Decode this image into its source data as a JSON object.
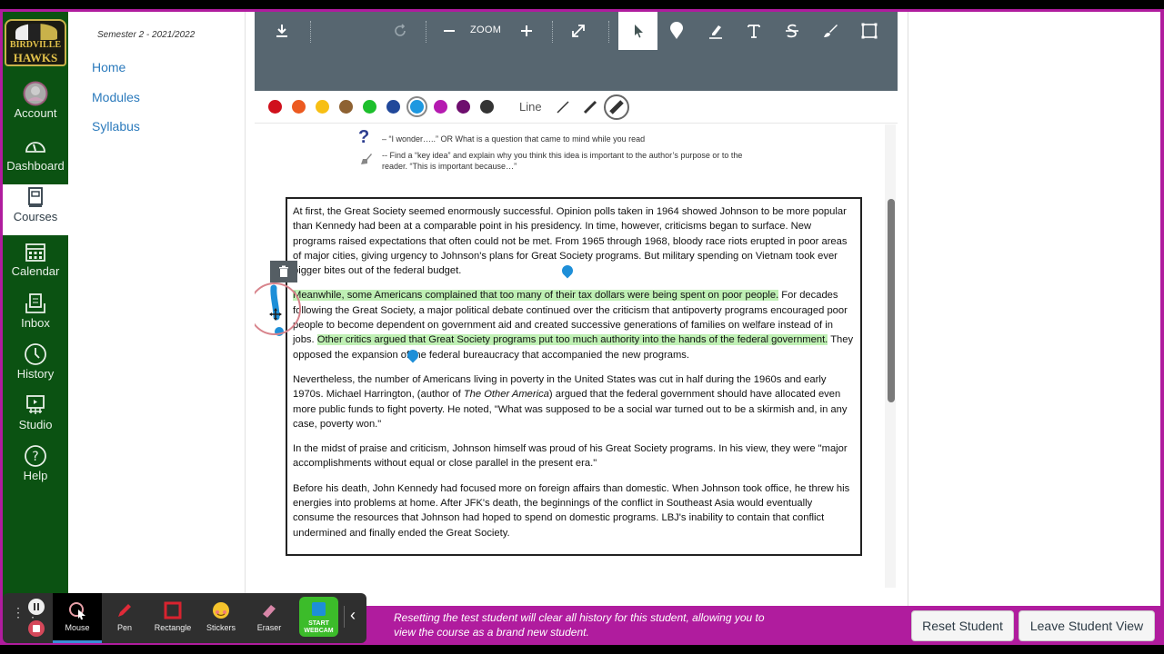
{
  "school_logo": {
    "line1": "BIRDVILLE",
    "line2": "HAWKS"
  },
  "global_nav": [
    {
      "label": "Account",
      "icon": "account-avatar-icon"
    },
    {
      "label": "Dashboard",
      "icon": "dashboard-icon"
    },
    {
      "label": "Courses",
      "icon": "courses-icon",
      "active": true
    },
    {
      "label": "Calendar",
      "icon": "calendar-icon"
    },
    {
      "label": "Inbox",
      "icon": "inbox-icon"
    },
    {
      "label": "History",
      "icon": "clock-icon"
    },
    {
      "label": "Studio",
      "icon": "studio-icon"
    },
    {
      "label": "Help",
      "icon": "help-icon"
    }
  ],
  "course_nav": {
    "term": "Semester 2 - 2021/2022",
    "links": [
      "Home",
      "Modules",
      "Syllabus"
    ]
  },
  "annotation_toolbar": {
    "zoom_label": "ZOOM",
    "tools": [
      "download-icon",
      "rotate-icon",
      "zoom-out-icon",
      "zoom-in-icon",
      "fullscreen-icon",
      "select-pointer-icon",
      "point-pin-icon",
      "highlight-icon",
      "text-icon",
      "strikeout-icon",
      "freehand-draw-icon",
      "area-icon"
    ],
    "selected_tool": "select-pointer-icon",
    "colors": [
      "#d0101c",
      "#ec5a20",
      "#f7bf14",
      "#8e6232",
      "#1dbf2c",
      "#21489a",
      "#1e98e0",
      "#b51ab0",
      "#6e0e6e",
      "#343434"
    ],
    "selected_color": "#1e98e0",
    "line_label": "Line",
    "line_widths": [
      "thin",
      "medium",
      "thick"
    ],
    "selected_line_width": "thick"
  },
  "document": {
    "legend": [
      {
        "icon": "question-mark-icon",
        "text": "– “I wonder…..” OR What is a question that came to mind while you read"
      },
      {
        "icon": "key-icon",
        "text": "-- Find a “key idea” and explain why you think this idea is important to the author’s purpose or to the reader. “This is important because…”"
      }
    ],
    "paragraphs": {
      "p1": "At first, the Great Society seemed enormously successful. Opinion polls taken in 1964 showed Johnson to be more popular than Kennedy had been at a comparable point in his presidency. In time, however, criticisms began to surface. New programs raised expectations that often could not be met. From 1965 through 1968, bloody race riots erupted in poor areas of major cities, giving urgency to Johnson's plans for Great Society programs. But military spending on Vietnam took ever bigger bites out of the federal budget.",
      "p2_highlight1": "Meanwhile, some Americans complained that too many of their tax dollars were being spent on poor people.",
      "p2_mid": " For decades following the Great Society, a major political debate continued over the criticism that antipoverty programs encouraged poor people to become dependent on government aid and created successive generations of families on welfare instead of in jobs. ",
      "p2_highlight2": "Other critics argued that Great Society programs put too much authority into the hands of the federal government.",
      "p2_end": " They opposed the expansion of the federal bureaucracy that accompanied the new programs.",
      "p3_a": "Nevertheless, the number of Americans living in poverty in the United States was cut in half during the 1960s and early 1970s. Michael Harrington, (author of ",
      "p3_italic": "The Other America",
      "p3_b": ") argued that the federal government should have allocated even more public funds to fight poverty. He noted, \"What was supposed to be a social war turned out to be a skirmish and, in any case, poverty won.\"",
      "p4": "In the midst of praise and criticism, Johnson himself was proud of his Great Society programs. In his view, they were \"major accomplishments without equal or close parallel in the present era.\"",
      "p5": "Before his death, John Kennedy had focused more on foreign affairs than domestic. When Johnson took office, he threw his energies into problems at home. After JFK's death, the beginnings of the conflict in Southeast Asia would eventually consume the resources that Johnson had hoped to spend on domestic programs. LBJ's inability to contain that conflict undermined and finally ended the Great Society."
    },
    "highlight_color": "#bff0b4",
    "pin_color": "#1e8fd8"
  },
  "recorder": {
    "tools": [
      {
        "label": "Mouse",
        "active": true
      },
      {
        "label": "Pen"
      },
      {
        "label": "Rectangle"
      },
      {
        "label": "Stickers"
      },
      {
        "label": "Eraser"
      }
    ],
    "webcam_label": "START WEBCAM"
  },
  "student_view": {
    "notice": "Resetting the test student will clear all history for this student, allowing you to view the course as a brand new student.",
    "reset_button": "Reset Student",
    "leave_button": "Leave Student View",
    "banner_color": "#b01c9e"
  }
}
